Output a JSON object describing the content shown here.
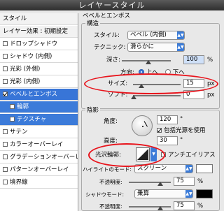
{
  "window_title": "レイヤースタイル",
  "sidebar": {
    "items": [
      {
        "label": "スタイル",
        "checkbox": false,
        "checked": false,
        "selected": false
      },
      {
        "label": "レイヤー効果 : 初期設定",
        "checkbox": false,
        "checked": false,
        "selected": false
      },
      {
        "label": "ドロップシャドウ",
        "checkbox": true,
        "checked": false,
        "selected": false
      },
      {
        "label": "シャドウ (内側)",
        "checkbox": true,
        "checked": false,
        "selected": false
      },
      {
        "label": "光彩 (外側)",
        "checkbox": true,
        "checked": false,
        "selected": false
      },
      {
        "label": "光彩 (内側)",
        "checkbox": true,
        "checked": false,
        "selected": false
      },
      {
        "label": "ベベルとエンボス",
        "checkbox": true,
        "checked": true,
        "selected": true
      },
      {
        "label": "輪郭",
        "checkbox": true,
        "checked": false,
        "selected": false,
        "indent": true
      },
      {
        "label": "テクスチャ",
        "checkbox": true,
        "checked": false,
        "selected": false,
        "indent": true
      },
      {
        "label": "サテン",
        "checkbox": true,
        "checked": false,
        "selected": false
      },
      {
        "label": "カラーオーバーレイ",
        "checkbox": true,
        "checked": false,
        "selected": false
      },
      {
        "label": "グラデーションオーバーレイ",
        "checkbox": true,
        "checked": false,
        "selected": false
      },
      {
        "label": "パターンオーバーレイ",
        "checkbox": true,
        "checked": false,
        "selected": false
      },
      {
        "label": "境界線",
        "checkbox": true,
        "checked": false,
        "selected": false
      }
    ]
  },
  "panel": {
    "section_title": "ベベルとエンボス",
    "structure": {
      "title": "構造",
      "style_label": "スタイル:",
      "style_value": "ベベル (内側)",
      "technique_label": "テクニック:",
      "technique_value": "滑らかに",
      "depth_label": "深さ:",
      "depth_value": "100",
      "depth_unit": "%",
      "direction_label": "方向:",
      "direction_up": "上へ",
      "direction_down": "下へ",
      "size_label": "サイズ:",
      "size_value": "15",
      "size_unit": "px",
      "soften_label": "ソフト:",
      "soften_value": "0",
      "soften_unit": "px"
    },
    "shading": {
      "title": "陰影",
      "angle_label": "角度:",
      "angle_value": "120",
      "angle_unit": "°",
      "global_light_label": "包括光源を使用",
      "altitude_label": "高度:",
      "altitude_value": "30",
      "altitude_unit": "°",
      "gloss_contour_label": "光沢輪郭:",
      "antialias_label": "アンチエイリアス",
      "highlight_mode_label": "ハイライトのモード:",
      "highlight_mode_value": "スクリーン",
      "highlight_opacity_label": "不透明度:",
      "highlight_opacity_value": "75",
      "shadow_mode_label": "シャドウモード:",
      "shadow_mode_value": "乗算",
      "shadow_opacity_label": "不透明度:",
      "shadow_opacity_value": "75",
      "percent": "%"
    }
  },
  "colors": {
    "highlight_color": "#ffffff",
    "shadow_color": "#000000",
    "selection": "#3875d7",
    "annotation": "#e8141c"
  }
}
